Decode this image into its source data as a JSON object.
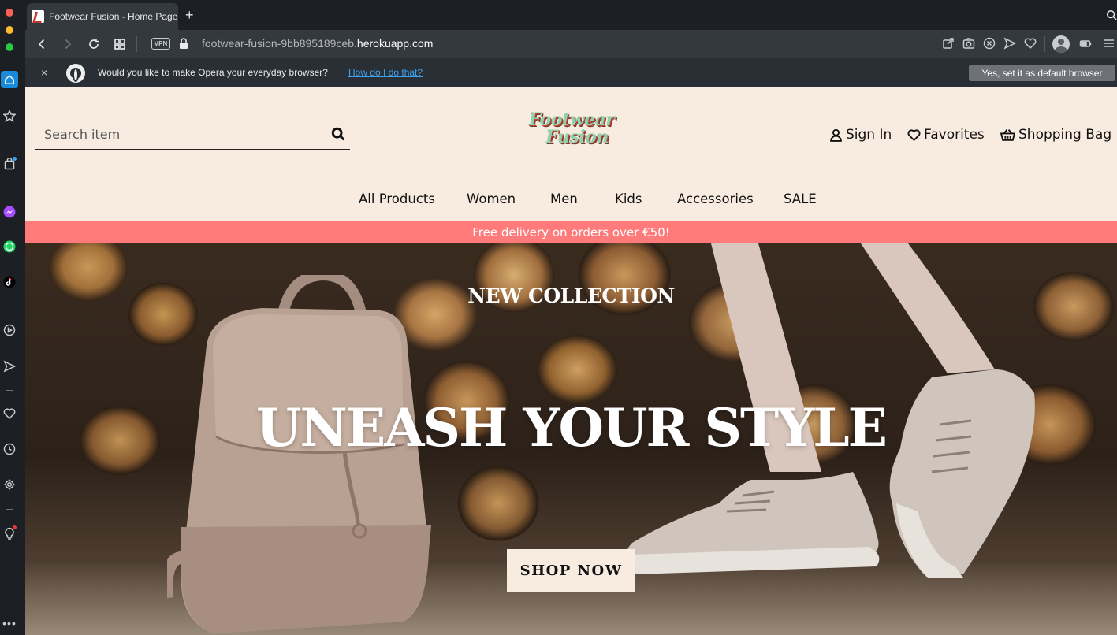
{
  "browser": {
    "tab_title": "Footwear Fusion - Home Page",
    "new_tab": "+",
    "url_prefix": "footwear-fusion-9bb895189ceb.",
    "url_domain": "herokuapp.com",
    "vpn_label": "VPN"
  },
  "banner": {
    "close": "×",
    "message": "Would you like to make Opera your everyday browser?",
    "link": "How do I do that?",
    "button": "Yes, set it as default browser"
  },
  "site": {
    "search_placeholder": "Search item",
    "logo_line1": "Footwear",
    "logo_line2": "Fusion",
    "sign_in": "Sign In",
    "favorites": "Favorites",
    "shopping_bag": "Shopping Bag",
    "nav": [
      "All Products",
      "Women",
      "Men",
      "Kids",
      "Accessories",
      "SALE"
    ],
    "promo": "Free delivery on orders over €50!",
    "hero_kicker": "NEW COLLECTION",
    "hero_title": "UNEASH YOUR STYLE",
    "hero_button": "SHOP NOW"
  },
  "colors": {
    "site_background": "#f8ece1",
    "promo_bar": "#ff7a7a",
    "browser_chrome": "#1c1f24",
    "opera_accent": "#1a8bd9"
  }
}
